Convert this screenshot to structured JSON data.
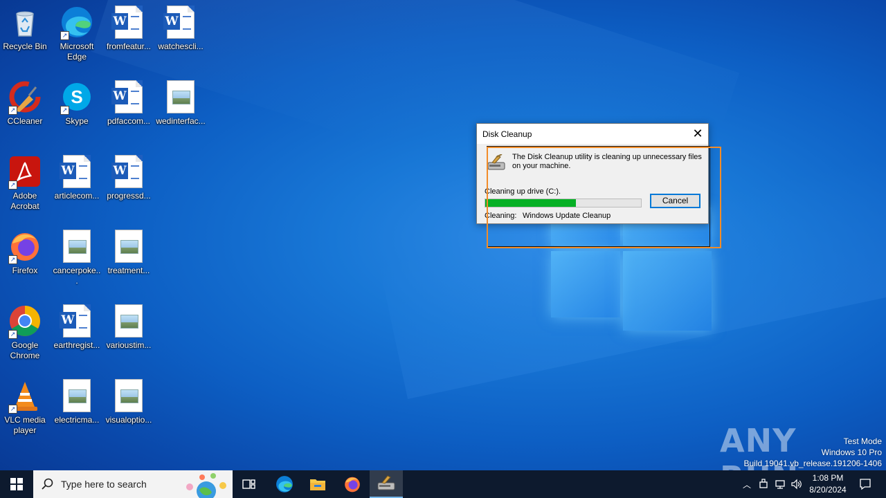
{
  "desktop": {
    "icons": [
      {
        "name": "recycle-bin",
        "label": "Recycle Bin"
      },
      {
        "name": "microsoft-edge",
        "label": "Microsoft Edge"
      },
      {
        "name": "fromfeatur",
        "label": "fromfeatur..."
      },
      {
        "name": "watchescli",
        "label": "watchescli..."
      },
      {
        "name": "ccleaner",
        "label": "CCleaner"
      },
      {
        "name": "skype",
        "label": "Skype"
      },
      {
        "name": "pdfaccom",
        "label": "pdfaccom..."
      },
      {
        "name": "wedinterfac",
        "label": "wedinterfac..."
      },
      {
        "name": "adobe-acrobat",
        "label": "Adobe Acrobat"
      },
      {
        "name": "articlecom",
        "label": "articlecom..."
      },
      {
        "name": "progressd",
        "label": "progressd..."
      },
      {
        "name": "firefox",
        "label": "Firefox"
      },
      {
        "name": "cancerpoke",
        "label": "cancerpoke..."
      },
      {
        "name": "treatment",
        "label": "treatment..."
      },
      {
        "name": "google-chrome",
        "label": "Google Chrome"
      },
      {
        "name": "earthregist",
        "label": "earthregist..."
      },
      {
        "name": "varioustim",
        "label": "varioustim..."
      },
      {
        "name": "vlc-media-player",
        "label": "VLC media player"
      },
      {
        "name": "electricma",
        "label": "electricma..."
      },
      {
        "name": "visualoptio",
        "label": "visualoptio..."
      }
    ]
  },
  "dialog": {
    "title": "Disk Cleanup",
    "message": "The Disk Cleanup utility is cleaning up unnecessary files on your machine.",
    "drive_label": "Cleaning up drive  (C:).",
    "progress": 0.58,
    "cancel_label": "Cancel",
    "cleaning_label": "Cleaning:",
    "cleaning_value": "Windows Update Cleanup"
  },
  "watermark": {
    "brand": "ANY RUN",
    "line1": "Test Mode",
    "line2": "Windows 10 Pro",
    "line3": "Build 19041.vb_release.191206-1406"
  },
  "taskbar": {
    "search_placeholder": "Type here to search",
    "time": "1:08 PM",
    "date": "8/20/2024"
  },
  "colors": {
    "progress_fill": "#06b025",
    "selection_outline": "#f28c28",
    "taskbar_bg": "#0d1a2e"
  }
}
